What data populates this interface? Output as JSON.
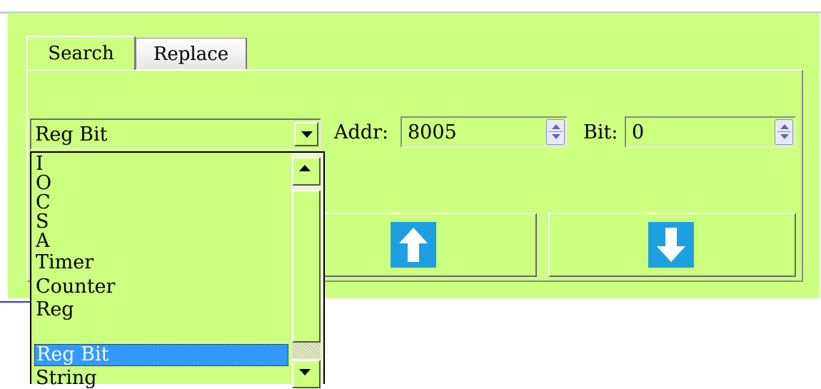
{
  "tabs": [
    {
      "label": "Search",
      "active": true
    },
    {
      "label": "Replace",
      "active": false
    }
  ],
  "search_type": {
    "selected": "Reg Bit",
    "options": [
      "I",
      "O",
      "C",
      "S",
      "A",
      "Timer",
      "Counter",
      "Reg",
      "Reg Bit",
      "String"
    ],
    "highlighted_index": 8
  },
  "addr": {
    "label": "Addr:",
    "value": "8005"
  },
  "bit": {
    "label": "Bit:",
    "value": "0"
  },
  "buttons": {
    "up_icon": "arrow-up-icon",
    "down_icon": "arrow-down-icon"
  },
  "colors": {
    "panel_bg": "#ccff80",
    "selection": "#3399ff",
    "arrow_box": "#1e9fe0"
  }
}
